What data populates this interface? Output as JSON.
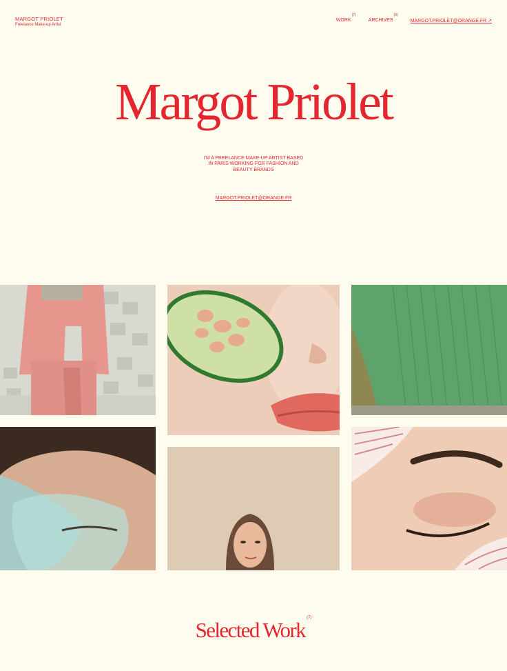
{
  "brand": {
    "name": "MARGOT PRIOLET",
    "role": "Freelance Make-up Artist"
  },
  "nav": {
    "work_label": "WORK",
    "work_count": "(7)",
    "archives_label": "ARCHIVES",
    "archives_count": "(9)",
    "email_link": "MARGOT.PRIOLET@ORANGE.FR ↗"
  },
  "hero": {
    "title": "Margot Priolet",
    "description": [
      "I'M A FREELANCE MAKE-UP ARTIST BASED",
      "IN PARIS WORKING FOR FASHION AND",
      "BEAUTY BRANDS"
    ],
    "email": "MARGOT.PRIOLET@ORANGE.FR"
  },
  "selected_work": {
    "title": "Selected Work",
    "count": "(7)"
  },
  "colors": {
    "accent": "#e3262f",
    "background": "#fdfcee"
  }
}
